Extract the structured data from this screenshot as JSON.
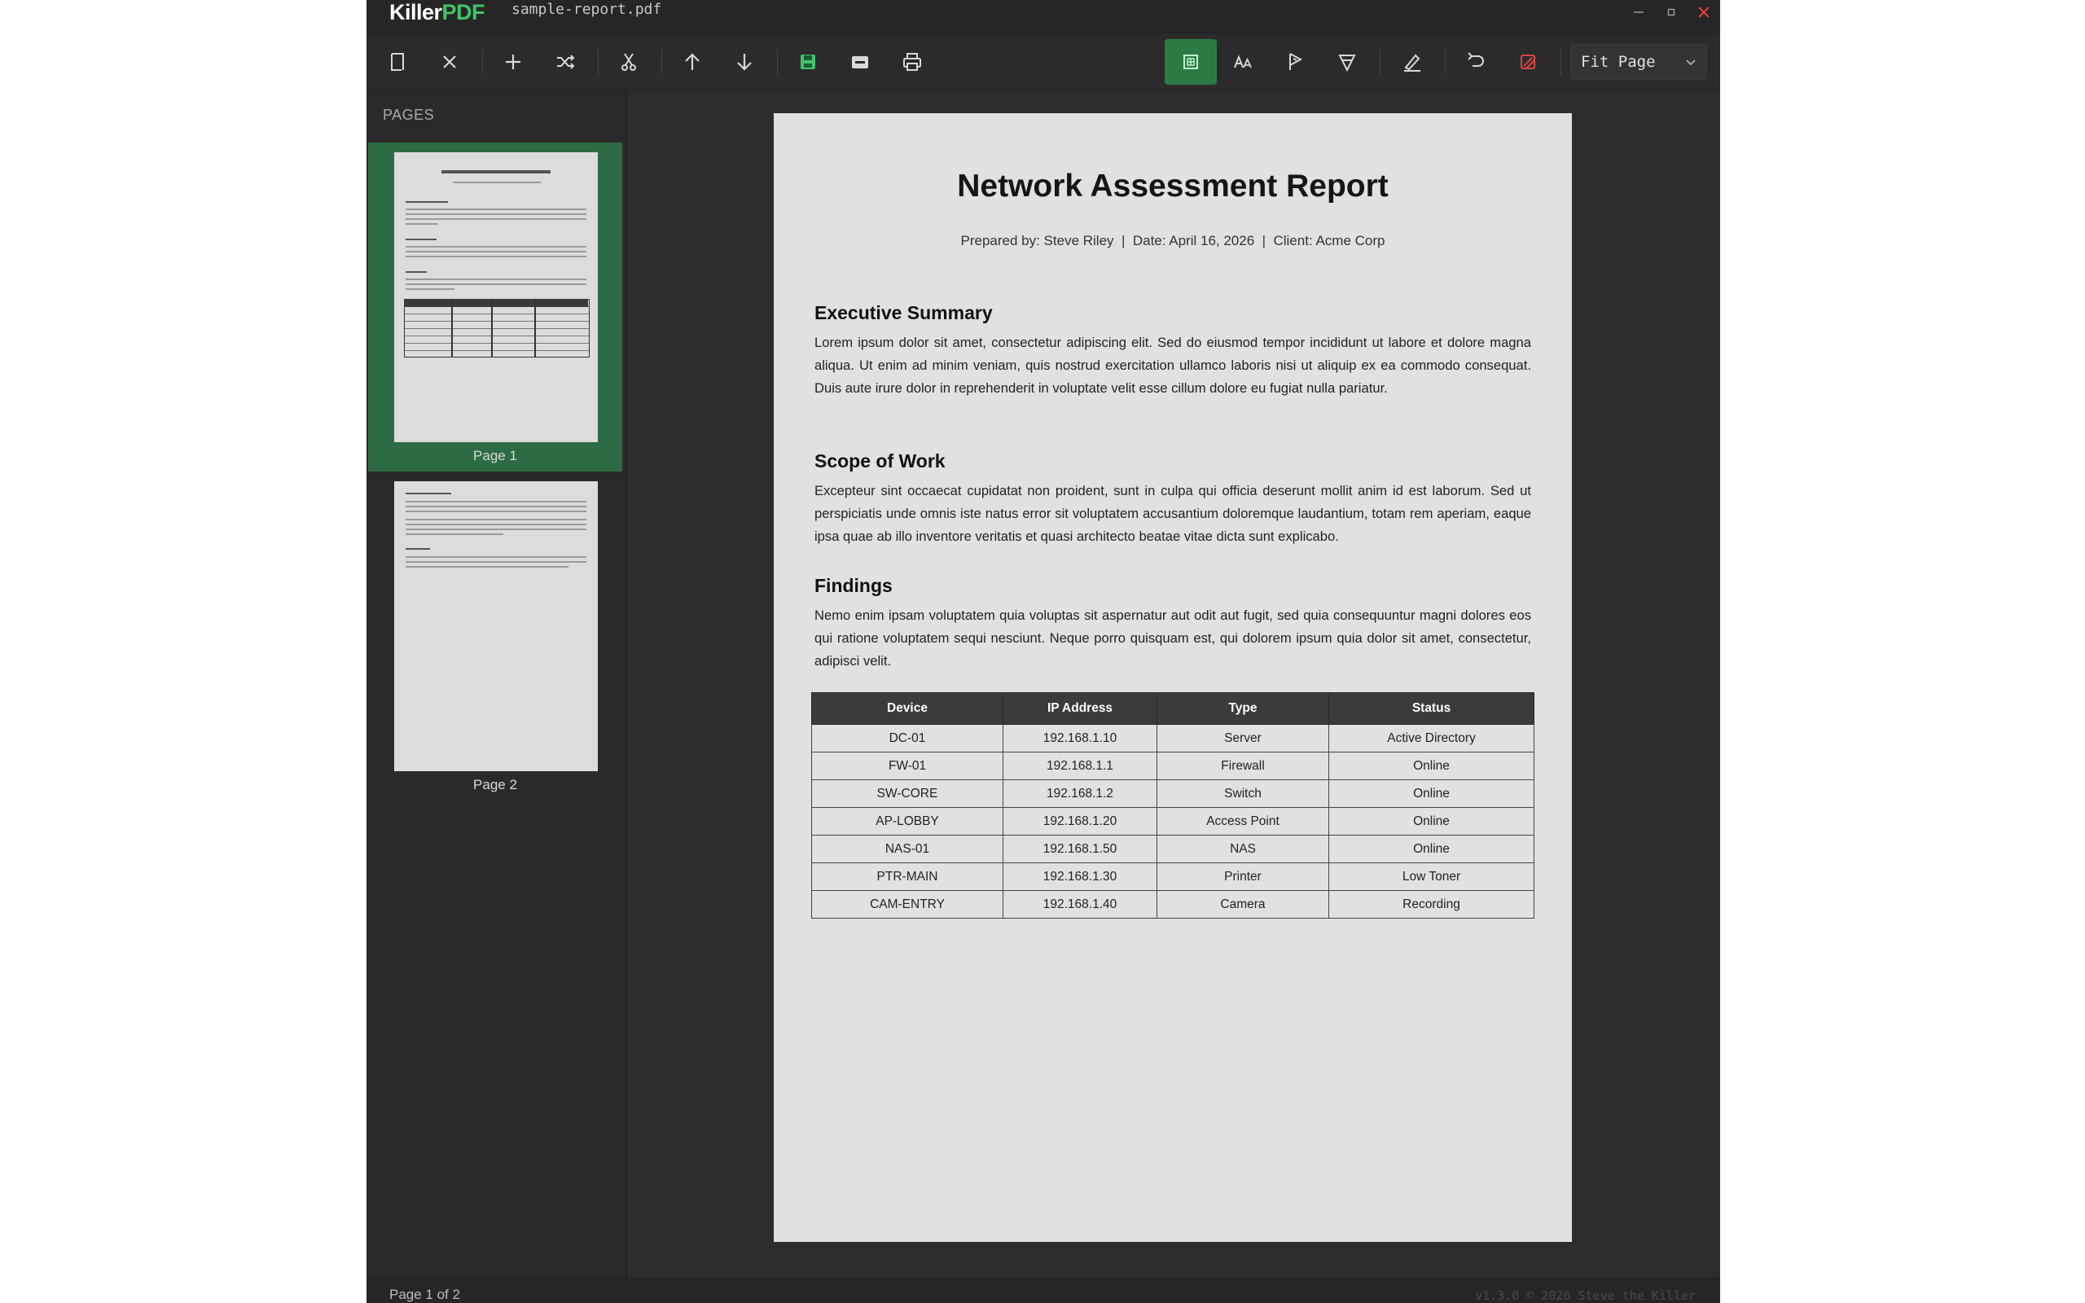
{
  "app": {
    "brand_main": "Killer",
    "brand_accent": "PDF",
    "filename": "sample-report.pdf",
    "accent_color": "#3fc46a"
  },
  "toolbar": {
    "icons": [
      "new-page-icon",
      "close-icon",
      "add-icon",
      "shuffle-icon",
      "cut-icon",
      "move-up-icon",
      "move-down-icon",
      "save-icon",
      "window-icon",
      "print-icon",
      "select-tool-icon",
      "text-tool-icon",
      "highlight-tool-icon",
      "markup-tool-icon",
      "sign-icon",
      "undo-icon",
      "clear-annotations-icon"
    ],
    "zoom_value": "Fit Page"
  },
  "sidebar": {
    "header": "PAGES",
    "pages": [
      {
        "label": "Page 1",
        "selected": true
      },
      {
        "label": "Page 2",
        "selected": false
      }
    ]
  },
  "document": {
    "title": "Network Assessment Report",
    "subtitle": "Prepared by: Steve Riley  |  Date: April 16, 2026  |  Client: Acme Corp",
    "sections": [
      {
        "heading": "Executive Summary",
        "text": "Lorem ipsum dolor sit amet, consectetur adipiscing elit. Sed do eiusmod tempor incididunt ut labore et dolore magna aliqua. Ut enim ad minim veniam, quis nostrud exercitation ullamco laboris nisi ut aliquip ex ea commodo consequat. Duis aute irure dolor in reprehenderit in voluptate velit esse cillum dolore eu fugiat nulla pariatur."
      },
      {
        "heading": "Scope of Work",
        "text": "Excepteur sint occaecat cupidatat non proident, sunt in culpa qui officia deserunt mollit anim id est laborum. Sed ut perspiciatis unde omnis iste natus error sit voluptatem accusantium doloremque laudantium, totam rem aperiam, eaque ipsa quae ab illo inventore veritatis et quasi architecto beatae vitae dicta sunt explicabo."
      },
      {
        "heading": "Findings",
        "text": "Nemo enim ipsam voluptatem quia voluptas sit aspernatur aut odit aut fugit, sed quia consequuntur magni dolores eos qui ratione voluptatem sequi nesciunt. Neque porro quisquam est, qui dolorem ipsum quia dolor sit amet, consectetur, adipisci velit."
      }
    ],
    "table": {
      "headers": [
        "Device",
        "IP Address",
        "Type",
        "Status"
      ],
      "rows": [
        [
          "DC-01",
          "192.168.1.10",
          "Server",
          "Active Directory"
        ],
        [
          "FW-01",
          "192.168.1.1",
          "Firewall",
          "Online"
        ],
        [
          "SW-CORE",
          "192.168.1.2",
          "Switch",
          "Online"
        ],
        [
          "AP-LOBBY",
          "192.168.1.20",
          "Access Point",
          "Online"
        ],
        [
          "NAS-01",
          "192.168.1.50",
          "NAS",
          "Online"
        ],
        [
          "PTR-MAIN",
          "192.168.1.30",
          "Printer",
          "Low Toner"
        ],
        [
          "CAM-ENTRY",
          "192.168.1.40",
          "Camera",
          "Recording"
        ]
      ]
    }
  },
  "status": {
    "page_indicator": "Page 1 of 2",
    "version": "v1.3.0  © 2026  Steve the Killer"
  }
}
